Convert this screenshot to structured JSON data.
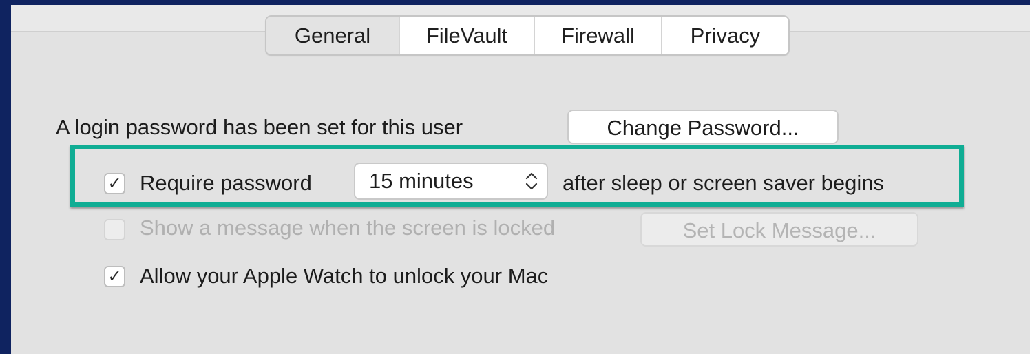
{
  "tabs": [
    {
      "label": "General",
      "selected": true
    },
    {
      "label": "FileVault",
      "selected": false
    },
    {
      "label": "Firewall",
      "selected": false
    },
    {
      "label": "Privacy",
      "selected": false
    }
  ],
  "login": {
    "label": "A login password has been set for this user",
    "change_button": "Change Password..."
  },
  "require_password": {
    "checked": true,
    "check_glyph": "✓",
    "label": "Require password",
    "select_value": "15 minutes",
    "after_label": "after sleep or screen saver begins"
  },
  "lock_message": {
    "checked": false,
    "label": "Show a message when the screen is locked",
    "button": "Set Lock Message..."
  },
  "apple_watch": {
    "checked": true,
    "check_glyph": "✓",
    "label": "Allow your Apple Watch to unlock your Mac"
  },
  "colors": {
    "background": "#0f2360",
    "panel": "#e2e2e2",
    "highlight": "#10ad94"
  },
  "icons": {
    "stepper": "up-down-chevron-icon",
    "check": "checkmark-icon"
  }
}
